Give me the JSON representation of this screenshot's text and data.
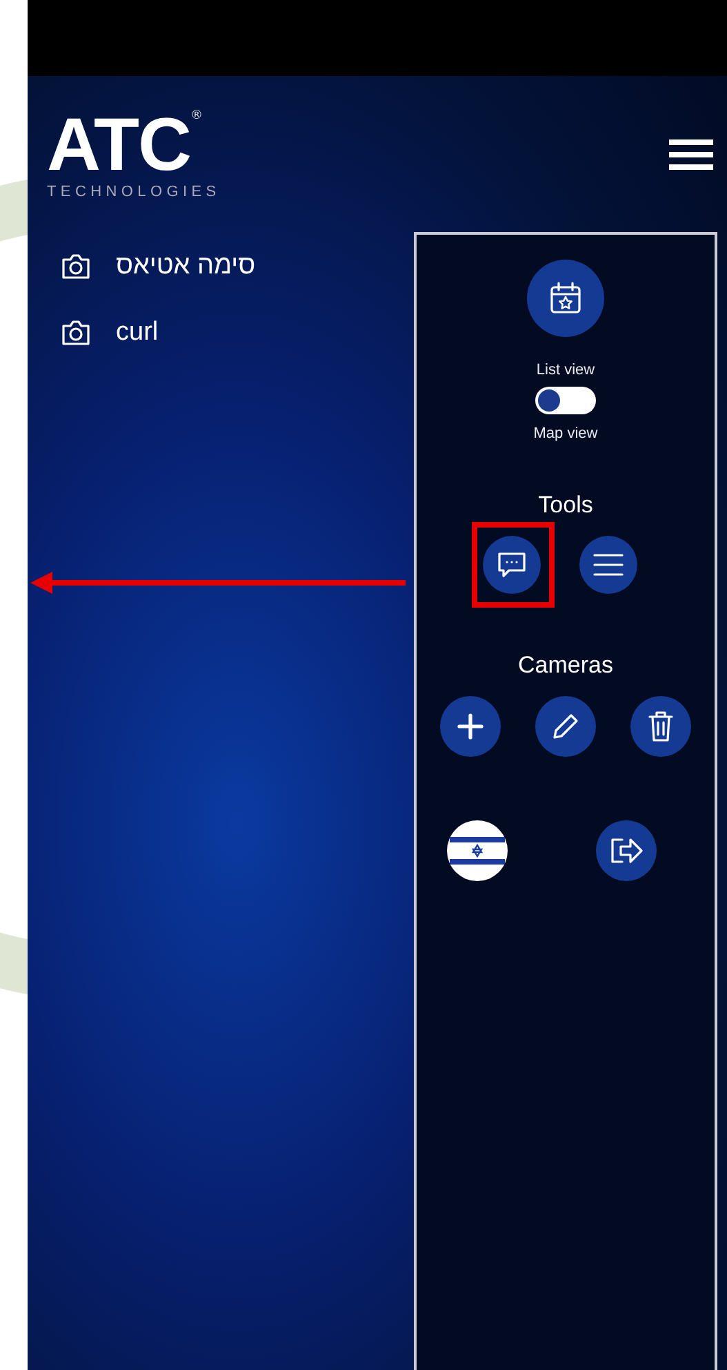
{
  "logo": {
    "mark": "ATC",
    "registered": "®",
    "subtitle": "TECHNOLOGIES"
  },
  "cameras": [
    {
      "name": "סימה אטיאס"
    },
    {
      "name": "curl"
    }
  ],
  "panel": {
    "list_label": "List view",
    "toggle": {
      "on": false
    },
    "map_label": "Map view",
    "tools_title": "Tools",
    "tools_highlighted": true,
    "cameras_title": "Cameras"
  }
}
